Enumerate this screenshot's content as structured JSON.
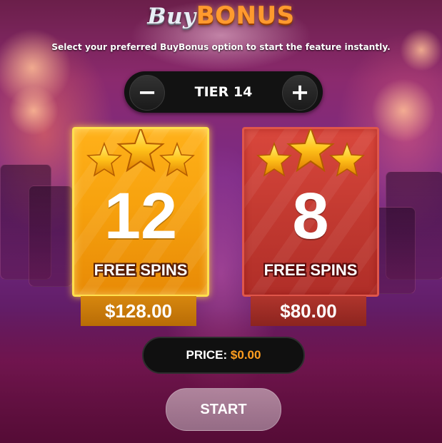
{
  "header": {
    "title_part1": "Buy",
    "title_part2": "BONUS",
    "subtitle": "Select your preferred BuyBonus option to start the feature instantly."
  },
  "tier": {
    "minus_label": "−",
    "plus_label": "+",
    "label": "TIER 14"
  },
  "options": [
    {
      "spins": "12",
      "spins_label": "FREE SPINS",
      "price": "$128.00",
      "style": "gold",
      "selected": true
    },
    {
      "spins": "8",
      "spins_label": "FREE SPINS",
      "price": "$80.00",
      "style": "red",
      "selected": false
    }
  ],
  "total": {
    "label": "PRICE:",
    "value": "$0.00"
  },
  "start_button": {
    "label": "START"
  },
  "colors": {
    "gold_card": "#f7a20e",
    "red_card": "#c33a31",
    "price_value": "#ff9d1f",
    "bonus_title": "#ff9a2e"
  },
  "icons": {
    "card_decoration": "three-stars-icon"
  }
}
